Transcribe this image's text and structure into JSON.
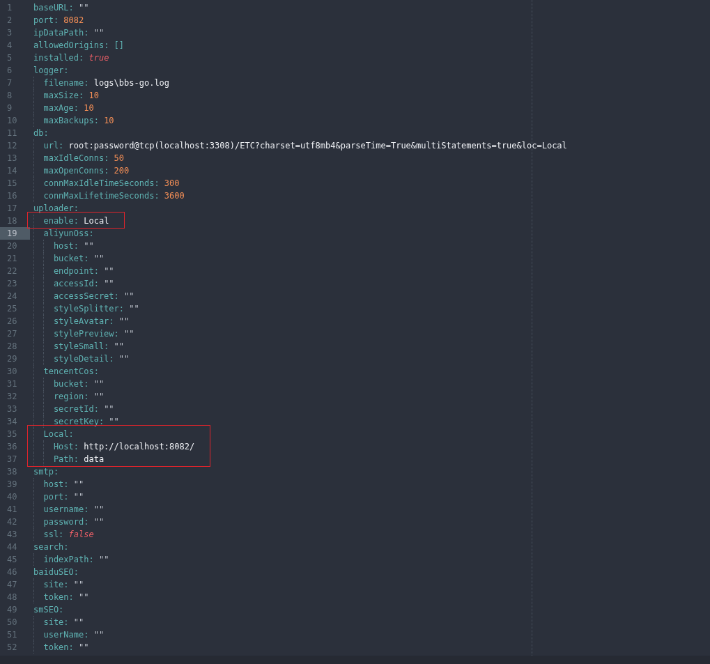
{
  "editor": {
    "entries": [
      {
        "line": "1",
        "key": "baseURL:",
        "value": "\"\"",
        "kind": "quoted",
        "current": false,
        "marked": false
      },
      {
        "line": "2",
        "key": "port:",
        "value": "8082",
        "kind": "number",
        "current": false,
        "marked": false
      },
      {
        "line": "3",
        "key": "ipDataPath:",
        "value": "\"\"",
        "kind": "quoted",
        "current": false,
        "marked": false
      },
      {
        "line": "4",
        "key": "allowedOrigins:",
        "value": "[]",
        "kind": "list",
        "current": false,
        "marked": false
      },
      {
        "line": "5",
        "key": "installed:",
        "value": "true",
        "kind": "bool",
        "current": false,
        "marked": false
      },
      {
        "line": "6",
        "key": "logger:",
        "kind": "section",
        "current": false,
        "marked": false,
        "children": [
          {
            "line": "7",
            "key": "filename:",
            "value": "logs\\bbs-go.log",
            "kind": "text",
            "current": false,
            "marked": false
          },
          {
            "line": "8",
            "key": "maxSize:",
            "value": "10",
            "kind": "number",
            "current": false,
            "marked": false
          },
          {
            "line": "9",
            "key": "maxAge:",
            "value": "10",
            "kind": "number",
            "current": false,
            "marked": false
          },
          {
            "line": "10",
            "key": "maxBackups:",
            "value": "10",
            "kind": "number",
            "current": false,
            "marked": false
          }
        ]
      },
      {
        "line": "11",
        "key": "db:",
        "kind": "section",
        "current": false,
        "marked": false,
        "children": [
          {
            "line": "12",
            "key": "url:",
            "value": "root:password@tcp(localhost:3308)/ETC?charset=utf8mb4&parseTime=True&multiStatements=true&loc=Local",
            "kind": "text",
            "current": false,
            "marked": false
          },
          {
            "line": "13",
            "key": "maxIdleConns:",
            "value": "50",
            "kind": "number",
            "current": false,
            "marked": false
          },
          {
            "line": "14",
            "key": "maxOpenConns:",
            "value": "200",
            "kind": "number",
            "current": false,
            "marked": false
          },
          {
            "line": "15",
            "key": "connMaxIdleTimeSeconds:",
            "value": "300",
            "kind": "number",
            "current": false,
            "marked": false
          },
          {
            "line": "16",
            "key": "connMaxLifetimeSeconds:",
            "value": "3600",
            "kind": "number",
            "current": false,
            "marked": false
          }
        ]
      },
      {
        "line": "17",
        "key": "uploader:",
        "kind": "section",
        "current": false,
        "marked": false,
        "children": [
          {
            "line": "18",
            "key": "enable:",
            "value": "Local",
            "kind": "text",
            "current": false,
            "marked": true
          },
          {
            "line": "19",
            "key": "aliyunOss:",
            "kind": "section",
            "current": true,
            "marked": false,
            "children": [
              {
                "line": "20",
                "key": "host:",
                "value": "\"\"",
                "kind": "quoted",
                "current": false,
                "marked": false
              },
              {
                "line": "21",
                "key": "bucket:",
                "value": "\"\"",
                "kind": "quoted",
                "current": false,
                "marked": false
              },
              {
                "line": "22",
                "key": "endpoint:",
                "value": "\"\"",
                "kind": "quoted",
                "current": false,
                "marked": false
              },
              {
                "line": "23",
                "key": "accessId:",
                "value": "\"\"",
                "kind": "quoted",
                "current": false,
                "marked": false
              },
              {
                "line": "24",
                "key": "accessSecret:",
                "value": "\"\"",
                "kind": "quoted",
                "current": false,
                "marked": false
              },
              {
                "line": "25",
                "key": "styleSplitter:",
                "value": "\"\"",
                "kind": "quoted",
                "current": false,
                "marked": false
              },
              {
                "line": "26",
                "key": "styleAvatar:",
                "value": "\"\"",
                "kind": "quoted",
                "current": false,
                "marked": false
              },
              {
                "line": "27",
                "key": "stylePreview:",
                "value": "\"\"",
                "kind": "quoted",
                "current": false,
                "marked": false
              },
              {
                "line": "28",
                "key": "styleSmall:",
                "value": "\"\"",
                "kind": "quoted",
                "current": false,
                "marked": false
              },
              {
                "line": "29",
                "key": "styleDetail:",
                "value": "\"\"",
                "kind": "quoted",
                "current": false,
                "marked": false
              }
            ]
          },
          {
            "line": "30",
            "key": "tencentCos:",
            "kind": "section",
            "current": false,
            "marked": false,
            "children": [
              {
                "line": "31",
                "key": "bucket:",
                "value": "\"\"",
                "kind": "quoted",
                "current": false,
                "marked": false
              },
              {
                "line": "32",
                "key": "region:",
                "value": "\"\"",
                "kind": "quoted",
                "current": false,
                "marked": false
              },
              {
                "line": "33",
                "key": "secretId:",
                "value": "\"\"",
                "kind": "quoted",
                "current": false,
                "marked": false
              },
              {
                "line": "34",
                "key": "secretKey:",
                "value": "\"\"",
                "kind": "quoted",
                "current": false,
                "marked": false
              }
            ]
          },
          {
            "line": "35",
            "key": "Local:",
            "kind": "section",
            "current": false,
            "marked": true,
            "children": [
              {
                "line": "36",
                "key": "Host:",
                "value": "http://localhost:8082/",
                "kind": "text",
                "current": false,
                "marked": true
              },
              {
                "line": "37",
                "key": "Path:",
                "value": "data",
                "kind": "text",
                "current": false,
                "marked": true
              }
            ]
          }
        ]
      },
      {
        "line": "38",
        "key": "smtp:",
        "kind": "section",
        "current": false,
        "marked": false,
        "children": [
          {
            "line": "39",
            "key": "host:",
            "value": "\"\"",
            "kind": "quoted",
            "current": false,
            "marked": false
          },
          {
            "line": "40",
            "key": "port:",
            "value": "\"\"",
            "kind": "quoted",
            "current": false,
            "marked": false
          },
          {
            "line": "41",
            "key": "username:",
            "value": "\"\"",
            "kind": "quoted",
            "current": false,
            "marked": false
          },
          {
            "line": "42",
            "key": "password:",
            "value": "\"\"",
            "kind": "quoted",
            "current": false,
            "marked": false
          },
          {
            "line": "43",
            "key": "ssl:",
            "value": "false",
            "kind": "bool",
            "current": false,
            "marked": false
          }
        ]
      },
      {
        "line": "44",
        "key": "search:",
        "kind": "section",
        "current": false,
        "marked": false,
        "children": [
          {
            "line": "45",
            "key": "indexPath:",
            "value": "\"\"",
            "kind": "quoted",
            "current": false,
            "marked": false
          }
        ]
      },
      {
        "line": "46",
        "key": "baiduSEO:",
        "kind": "section",
        "current": false,
        "marked": false,
        "children": [
          {
            "line": "47",
            "key": "site:",
            "value": "\"\"",
            "kind": "quoted",
            "current": false,
            "marked": false
          },
          {
            "line": "48",
            "key": "token:",
            "value": "\"\"",
            "kind": "quoted",
            "current": false,
            "marked": false
          }
        ]
      },
      {
        "line": "49",
        "key": "smSEO:",
        "kind": "section",
        "current": false,
        "marked": false,
        "children": [
          {
            "line": "50",
            "key": "site:",
            "value": "\"\"",
            "kind": "quoted",
            "current": false,
            "marked": false
          },
          {
            "line": "51",
            "key": "userName:",
            "value": "\"\"",
            "kind": "quoted",
            "current": false,
            "marked": false
          },
          {
            "line": "52",
            "key": "token:",
            "value": "\"\"",
            "kind": "quoted",
            "current": false,
            "marked": false
          }
        ]
      }
    ]
  }
}
